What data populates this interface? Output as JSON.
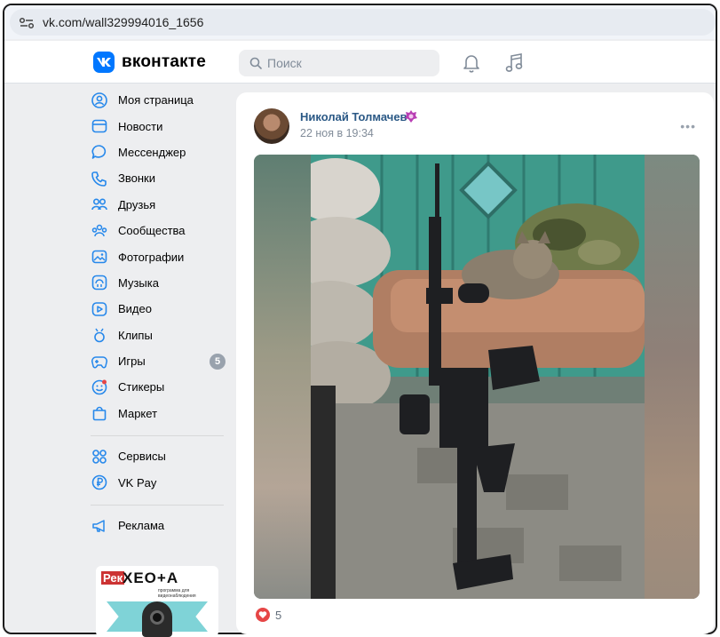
{
  "browser": {
    "url": "vk.com/wall329994016_1656"
  },
  "header": {
    "brand": "вконтакте",
    "search_placeholder": "Поиск"
  },
  "sidebar": {
    "items": [
      {
        "label": "Моя страница",
        "icon": "user-circle-icon"
      },
      {
        "label": "Новости",
        "icon": "news-icon"
      },
      {
        "label": "Мессенджер",
        "icon": "chat-bubble-icon"
      },
      {
        "label": "Звонки",
        "icon": "phone-icon"
      },
      {
        "label": "Друзья",
        "icon": "friends-icon"
      },
      {
        "label": "Сообщества",
        "icon": "communities-icon"
      },
      {
        "label": "Фотографии",
        "icon": "photo-icon"
      },
      {
        "label": "Музыка",
        "icon": "music-icon"
      },
      {
        "label": "Видео",
        "icon": "video-icon"
      },
      {
        "label": "Клипы",
        "icon": "clips-icon"
      },
      {
        "label": "Игры",
        "icon": "gamepad-icon",
        "badge": "5"
      },
      {
        "label": "Стикеры",
        "icon": "sticker-icon"
      },
      {
        "label": "Маркет",
        "icon": "shopping-bag-icon"
      }
    ],
    "items2": [
      {
        "label": "Сервисы",
        "icon": "services-icon"
      },
      {
        "label": "VK Pay",
        "icon": "vkpay-icon"
      }
    ],
    "items3": [
      {
        "label": "Реклама",
        "icon": "megaphone-icon"
      }
    ],
    "ad": {
      "tag": "Рек",
      "brand": "XEO+A",
      "subtitle": "программа для видеонаблюдения"
    }
  },
  "post": {
    "author": "Николай Толмачев",
    "date": "22 ноя в 19:34",
    "likes": "5"
  },
  "colors": {
    "vk_blue": "#0077ff",
    "link": "#2a5885",
    "muted": "#818c99",
    "like_red": "#e64646"
  }
}
